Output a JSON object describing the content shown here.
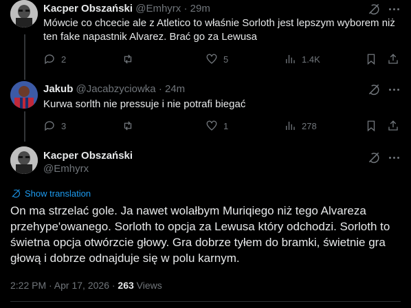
{
  "replies": [
    {
      "name": "Kacper Obszański",
      "handle": "@Emhyrx",
      "sep": "·",
      "time": "29m",
      "text": "Mówcie co chcecie ale z Atletico to właśnie Sorloth jest lepszym wyborem niż ten fake napastnik Alvarez. Brać go za Lewusa",
      "replies_count": "2",
      "reposts_count": "",
      "likes_count": "5",
      "views_count": "1.4K"
    },
    {
      "name": "Jakub",
      "handle": "@Jacabzyciowka",
      "sep": "·",
      "time": "24m",
      "text": "Kurwa sorlth nie pressuje i nie potrafi biegać",
      "replies_count": "3",
      "reposts_count": "",
      "likes_count": "1",
      "views_count": "278"
    }
  ],
  "main": {
    "name": "Kacper Obszański",
    "handle": "@Emhyrx",
    "translate_label": "Show translation",
    "text": "On ma strzelać gole. Ja nawet wolałbym Muriqiego niż tego Alvareza przehype'owanego. Sorloth to opcja za Lewusa który odchodzi. Sorloth to świetna opcja otwórzcie głowy. Gra dobrze tyłem do bramki, świetnie gra głową i dobrze odnajduje się w polu karnym.",
    "timestamp": "2:22 PM · Apr 17, 2026 ·",
    "views_number": "263",
    "views_label": "Views"
  },
  "colors": {
    "background": "#000000",
    "text": "#e7e9ea",
    "muted": "#71767b",
    "link": "#1d9bf0",
    "divider": "#2f3336"
  }
}
